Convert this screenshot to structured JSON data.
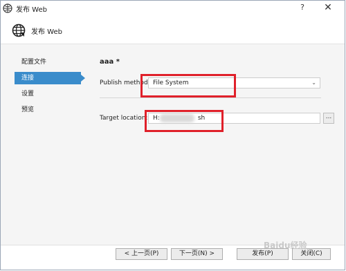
{
  "window": {
    "title": "发布 Web",
    "help_glyph": "?",
    "close_glyph": "✕"
  },
  "header": {
    "title": "发布 Web"
  },
  "sidebar": {
    "items": [
      {
        "label": "配置文件",
        "active": false
      },
      {
        "label": "连接",
        "active": true
      },
      {
        "label": "设置",
        "active": false
      },
      {
        "label": "预览",
        "active": false
      }
    ]
  },
  "main": {
    "profile_name": "aaa *",
    "publish_method": {
      "label": "Publish method:",
      "value": "File System",
      "chevron": "⌄"
    },
    "target_location": {
      "label": "Target location:",
      "value_prefix": "H:",
      "value_suffix": "sh",
      "browse_label": "..."
    }
  },
  "footer": {
    "prev_label": "< 上一页(P)",
    "next_label": "下一页(N) >",
    "publish_label": "发布(P)",
    "close_label": "关闭(C)"
  },
  "watermark": "Baidu经验",
  "colors": {
    "accent": "#3a8ccb",
    "highlight_box": "#e0202a"
  }
}
